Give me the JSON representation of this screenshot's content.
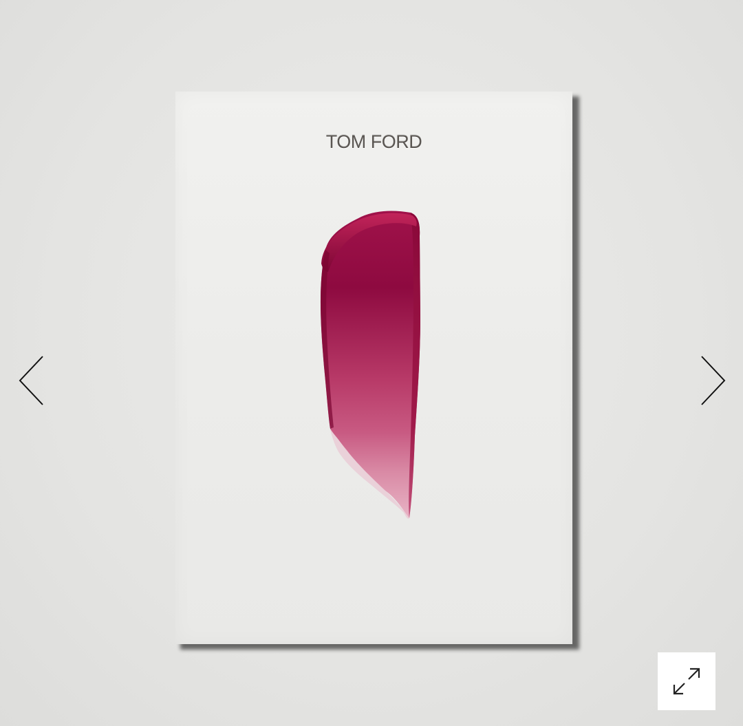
{
  "gallery": {
    "brand_text": "TOM FORD",
    "swatch_color": "#8b0a3e",
    "prev_icon": "chevron-left-icon",
    "next_icon": "chevron-right-icon",
    "fullscreen_icon": "expand-icon"
  }
}
